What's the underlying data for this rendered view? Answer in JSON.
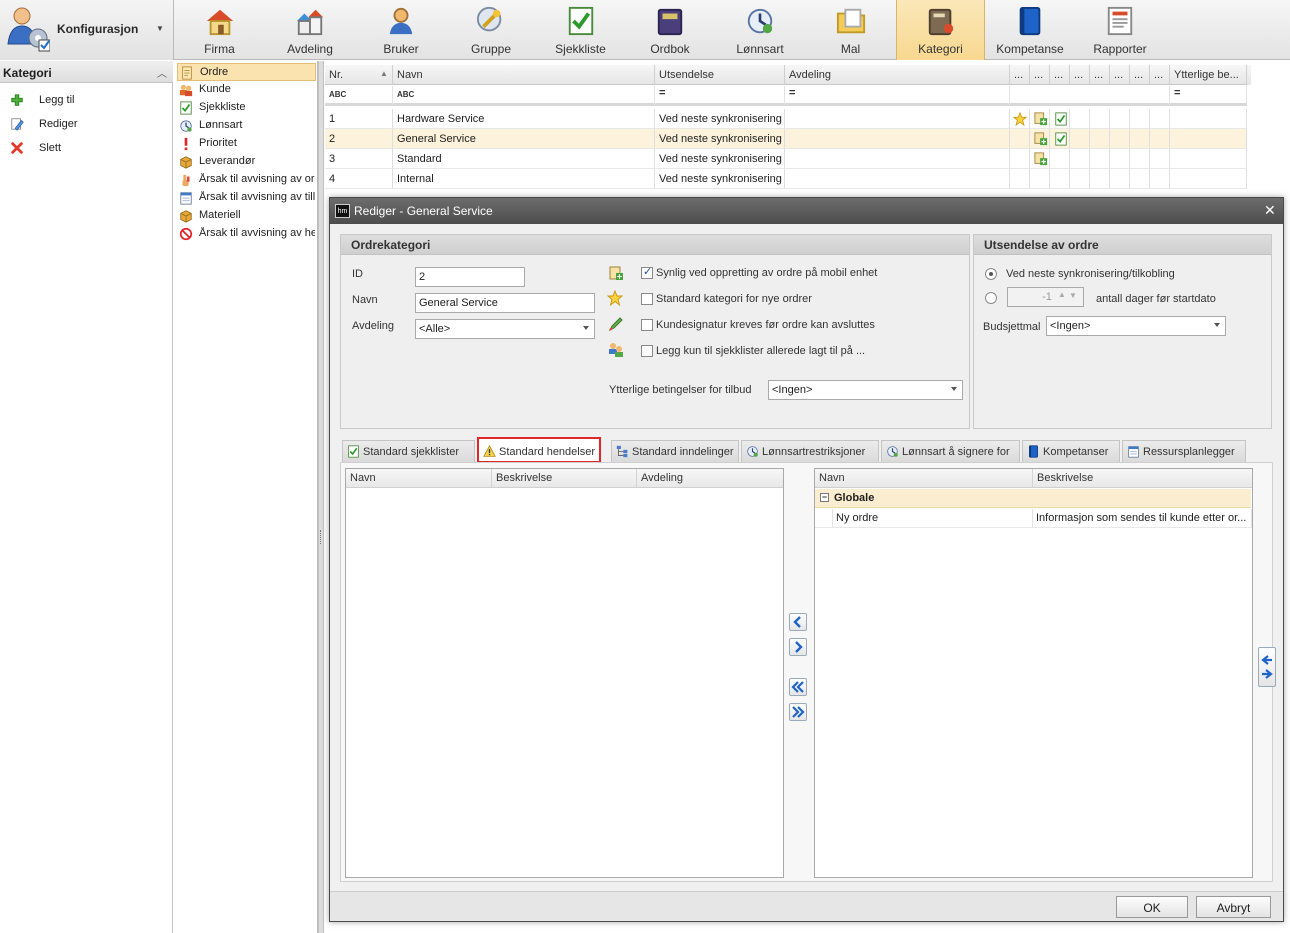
{
  "app": {
    "title": "Konfigurasjon"
  },
  "ribbon": {
    "items": [
      {
        "label": "Firma",
        "icon": "house-icon"
      },
      {
        "label": "Avdeling",
        "icon": "buildings-icon"
      },
      {
        "label": "Bruker",
        "icon": "user-icon"
      },
      {
        "label": "Gruppe",
        "icon": "group-keys-icon"
      },
      {
        "label": "Sjekkliste",
        "icon": "checklist-icon"
      },
      {
        "label": "Ordbok",
        "icon": "dictionary-icon"
      },
      {
        "label": "Lønnsart",
        "icon": "wage-clock-icon"
      },
      {
        "label": "Mal",
        "icon": "template-folder-icon"
      },
      {
        "label": "Kategori",
        "icon": "category-book-icon",
        "active": true
      },
      {
        "label": "Kompetanse",
        "icon": "competence-book-icon"
      },
      {
        "label": "Rapporter",
        "icon": "report-icon"
      }
    ]
  },
  "leftnav": {
    "title": "Kategori",
    "actions": [
      {
        "label": "Legg til",
        "icon": "add-icon"
      },
      {
        "label": "Rediger",
        "icon": "edit-icon"
      },
      {
        "label": "Slett",
        "icon": "delete-icon"
      }
    ]
  },
  "categories": [
    {
      "label": "Ordre",
      "icon": "order-icon",
      "selected": true
    },
    {
      "label": "Kunde",
      "icon": "customer-icon"
    },
    {
      "label": "Sjekkliste",
      "icon": "checklist-icon"
    },
    {
      "label": "Lønnsart",
      "icon": "wage-clock-icon"
    },
    {
      "label": "Prioritet",
      "icon": "priority-icon"
    },
    {
      "label": "Leverandør",
      "icon": "supplier-box-icon"
    },
    {
      "label": "Årsak til avvisning av or",
      "icon": "hand-icon"
    },
    {
      "label": "Årsak til avvisning av till",
      "icon": "calendar-icon"
    },
    {
      "label": "Materiell",
      "icon": "material-box-icon"
    },
    {
      "label": "Årsak til avvisning av he",
      "icon": "forbidden-icon"
    }
  ],
  "grid": {
    "columns": {
      "nr": "Nr.",
      "navn": "Navn",
      "utsendelse": "Utsendelse",
      "avdeling": "Avdeling",
      "dots": "...",
      "ytterlige": "Ytterlige be..."
    },
    "filter": {
      "abc": "ABC",
      "eq": "="
    },
    "rows": [
      {
        "nr": "1",
        "navn": "Hardware Service",
        "utsendelse": "Ved neste synkronisering",
        "avdeling": "",
        "star": true,
        "order": true,
        "check": true
      },
      {
        "nr": "2",
        "navn": "General Service",
        "utsendelse": "Ved neste synkronisering",
        "avdeling": "",
        "star": false,
        "order": true,
        "check": true
      },
      {
        "nr": "3",
        "navn": "Standard",
        "utsendelse": "Ved neste synkronisering",
        "avdeling": "",
        "star": false,
        "order": true,
        "check": false
      },
      {
        "nr": "4",
        "navn": "Internal",
        "utsendelse": "Ved neste synkronisering",
        "avdeling": "",
        "star": false,
        "order": false,
        "check": false
      }
    ]
  },
  "dialog": {
    "logo": "hm",
    "title": "Rediger - General Service",
    "ordrekategori": {
      "title": "Ordrekategori",
      "id_label": "ID",
      "id_value": "2",
      "navn_label": "Navn",
      "navn_value": "General Service",
      "avdeling_label": "Avdeling",
      "avdeling_value": "<Alle>",
      "options": [
        {
          "label": "Synlig ved oppretting av ordre på mobil enhet",
          "checked": true,
          "icon": "mobile-order-icon"
        },
        {
          "label": "Standard kategori for nye ordrer",
          "checked": false,
          "icon": "star-icon"
        },
        {
          "label": "Kundesignatur kreves før ordre kan avsluttes",
          "checked": false,
          "icon": "pen-icon"
        },
        {
          "label": "Legg kun til sjekklister allerede lagt til på ...",
          "checked": false,
          "icon": "users-icon"
        }
      ],
      "tilbud_label": "Ytterlige betingelser for tilbud",
      "tilbud_value": "<Ingen>"
    },
    "utsendelse": {
      "title": "Utsendelse av ordre",
      "radio1": "Ved neste synkronisering/tilkobling",
      "days_value": "-1",
      "radio2": "antall dager før startdato",
      "budsjett_label": "Budsjettmal",
      "budsjett_value": "<Ingen>"
    },
    "tabs": [
      {
        "label": "Standard sjekklister",
        "icon": "checklist-icon"
      },
      {
        "label": "Standard hendelser",
        "icon": "event-warning-icon",
        "active": true
      },
      {
        "label": "Standard inndelinger",
        "icon": "tree-icon"
      },
      {
        "label": "Lønnsartrestriksjoner",
        "icon": "wage-clock-icon"
      },
      {
        "label": "Lønnsart å signere for",
        "icon": "wage-clock-icon"
      },
      {
        "label": "Kompetanser",
        "icon": "competence-book-icon"
      },
      {
        "label": "Ressursplanlegger",
        "icon": "calendar-icon"
      }
    ],
    "left_panel": {
      "col_navn": "Navn",
      "col_beskrivelse": "Beskrivelse",
      "col_avdeling": "Avdeling"
    },
    "right_panel": {
      "col_navn": "Navn",
      "col_beskrivelse": "Beskrivelse",
      "group": "Globale",
      "rows": [
        {
          "navn": "Ny ordre",
          "beskrivelse": "Informasjon som sendes til kunde etter or..."
        }
      ]
    },
    "buttons": {
      "ok": "OK",
      "cancel": "Avbryt"
    }
  },
  "colors": {
    "selection": "#fbe3b0",
    "active_tab_outline": "#e0262b",
    "titlebar": "#555555"
  }
}
